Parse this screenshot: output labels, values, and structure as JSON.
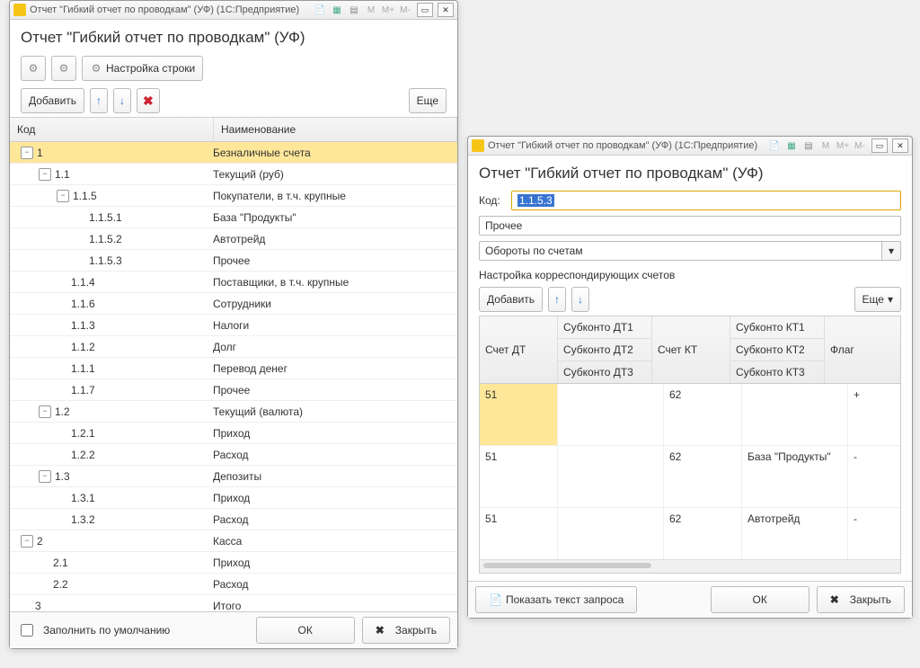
{
  "windowLeft": {
    "titlebar": "Отчет \"Гибкий отчет по проводкам\" (УФ)  (1С:Предприятие)",
    "pageTitle": "Отчет \"Гибкий отчет по проводкам\" (УФ)",
    "settingsLabel": "Настройка строки",
    "addLabel": "Добавить",
    "moreLabel": "Еще",
    "colCode": "Код",
    "colName": "Наименование",
    "rows": [
      {
        "lvl": 0,
        "exp": "-",
        "code": "1",
        "name": "Безналичные счета",
        "sel": true
      },
      {
        "lvl": 1,
        "exp": "-",
        "code": "1.1",
        "name": "Текущий (руб)"
      },
      {
        "lvl": 2,
        "exp": "-",
        "code": "1.1.5",
        "name": "Покупатели, в т.ч. крупные"
      },
      {
        "lvl": 3,
        "exp": "",
        "code": "1.1.5.1",
        "name": "База \"Продукты\""
      },
      {
        "lvl": 3,
        "exp": "",
        "code": "1.1.5.2",
        "name": "Автотрейд"
      },
      {
        "lvl": 3,
        "exp": "",
        "code": "1.1.5.3",
        "name": "Прочее"
      },
      {
        "lvl": 2,
        "exp": "",
        "code": "1.1.4",
        "name": "Поставщики, в т.ч. крупные"
      },
      {
        "lvl": 2,
        "exp": "",
        "code": "1.1.6",
        "name": "Сотрудники"
      },
      {
        "lvl": 2,
        "exp": "",
        "code": "1.1.3",
        "name": "Налоги"
      },
      {
        "lvl": 2,
        "exp": "",
        "code": "1.1.2",
        "name": "Долг"
      },
      {
        "lvl": 2,
        "exp": "",
        "code": "1.1.1",
        "name": "Перевод денег"
      },
      {
        "lvl": 2,
        "exp": "",
        "code": "1.1.7",
        "name": "Прочее"
      },
      {
        "lvl": 1,
        "exp": "-",
        "code": "1.2",
        "name": "Текущий (валюта)"
      },
      {
        "lvl": 2,
        "exp": "",
        "code": "1.2.1",
        "name": "Приход"
      },
      {
        "lvl": 2,
        "exp": "",
        "code": "1.2.2",
        "name": "Расход"
      },
      {
        "lvl": 1,
        "exp": "-",
        "code": "1.3",
        "name": "Депозиты"
      },
      {
        "lvl": 2,
        "exp": "",
        "code": "1.3.1",
        "name": "Приход"
      },
      {
        "lvl": 2,
        "exp": "",
        "code": "1.3.2",
        "name": "Расход"
      },
      {
        "lvl": 0,
        "exp": "-",
        "code": "2",
        "name": "Касса"
      },
      {
        "lvl": 1,
        "exp": "",
        "code": "2.1",
        "name": "Приход"
      },
      {
        "lvl": 1,
        "exp": "",
        "code": "2.2",
        "name": "Расход"
      },
      {
        "lvl": 0,
        "exp": "",
        "code": "3",
        "name": "Итого"
      }
    ],
    "fillDefault": "Заполнить по умолчанию",
    "ok": "ОК",
    "close": "Закрыть"
  },
  "windowRight": {
    "titlebar": "Отчет \"Гибкий отчет по проводкам\" (УФ)  (1С:Предприятие)",
    "pageTitle": "Отчет \"Гибкий отчет по проводкам\" (УФ)",
    "codeLabel": "Код:",
    "codeValue": "1.1.5.3",
    "nameValue": "Прочее",
    "ddValue": "Обороты по счетам",
    "sectLabel": "Настройка корреспондирующих счетов",
    "addLabel": "Добавить",
    "moreLabel": "Еще",
    "headers": {
      "dt": "Счет ДТ",
      "sub1": "Субконто ДТ1",
      "sub2": "Субконто ДТ2",
      "sub3": "Субконто ДТ3",
      "kt": "Счет КТ",
      "ksub1": "Субконто КТ1",
      "ksub2": "Субконто КТ2",
      "ksub3": "Субконто КТ3",
      "flag": "Флаг"
    },
    "grows": [
      {
        "dt": "51",
        "sub": "",
        "kt": "62",
        "ksub": "",
        "flag": "+",
        "sel": true
      },
      {
        "dt": "51",
        "sub": "",
        "kt": "62",
        "ksub": "База \"Продукты\"",
        "flag": "-"
      },
      {
        "dt": "51",
        "sub": "",
        "kt": "62",
        "ksub": "Автотрейд",
        "flag": "-"
      }
    ],
    "showQuery": "Показать текст запроса",
    "ok": "ОК",
    "close": "Закрыть"
  },
  "tbM": [
    "M",
    "M+",
    "M-"
  ]
}
